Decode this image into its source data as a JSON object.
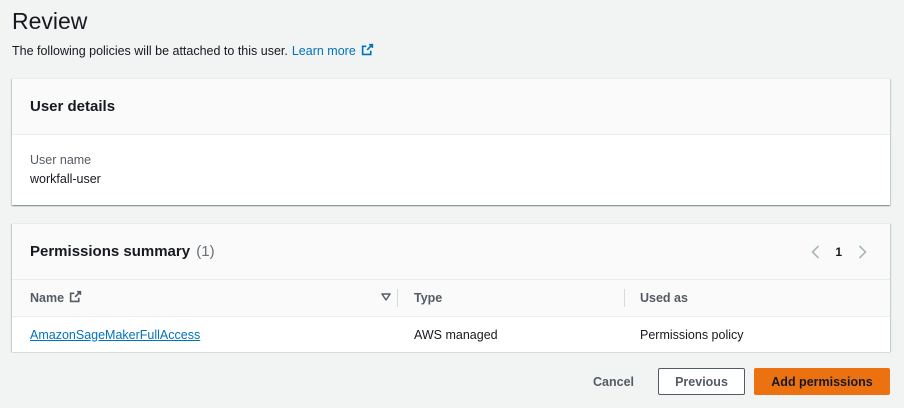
{
  "page": {
    "title": "Review",
    "subtitle": "The following policies will be attached to this user.",
    "learn_more": "Learn more"
  },
  "user_details": {
    "title": "User details",
    "field_label": "User name",
    "field_value": "workfall-user"
  },
  "permissions": {
    "title": "Permissions summary",
    "count": "(1)",
    "page": "1",
    "columns": [
      "Name",
      "Type",
      "Used as"
    ],
    "rows": [
      {
        "name": "AmazonSageMakerFullAccess",
        "type": "AWS managed",
        "used_as": "Permissions policy"
      }
    ]
  },
  "actions": {
    "cancel": "Cancel",
    "previous": "Previous",
    "submit": "Add permissions"
  },
  "colors": {
    "link": "#0073bb",
    "primary": "#ec7211",
    "background": "#f2f3f3"
  },
  "icons": [
    "external-link-icon",
    "chevron-left-icon",
    "chevron-right-icon",
    "sort-down-icon"
  ]
}
